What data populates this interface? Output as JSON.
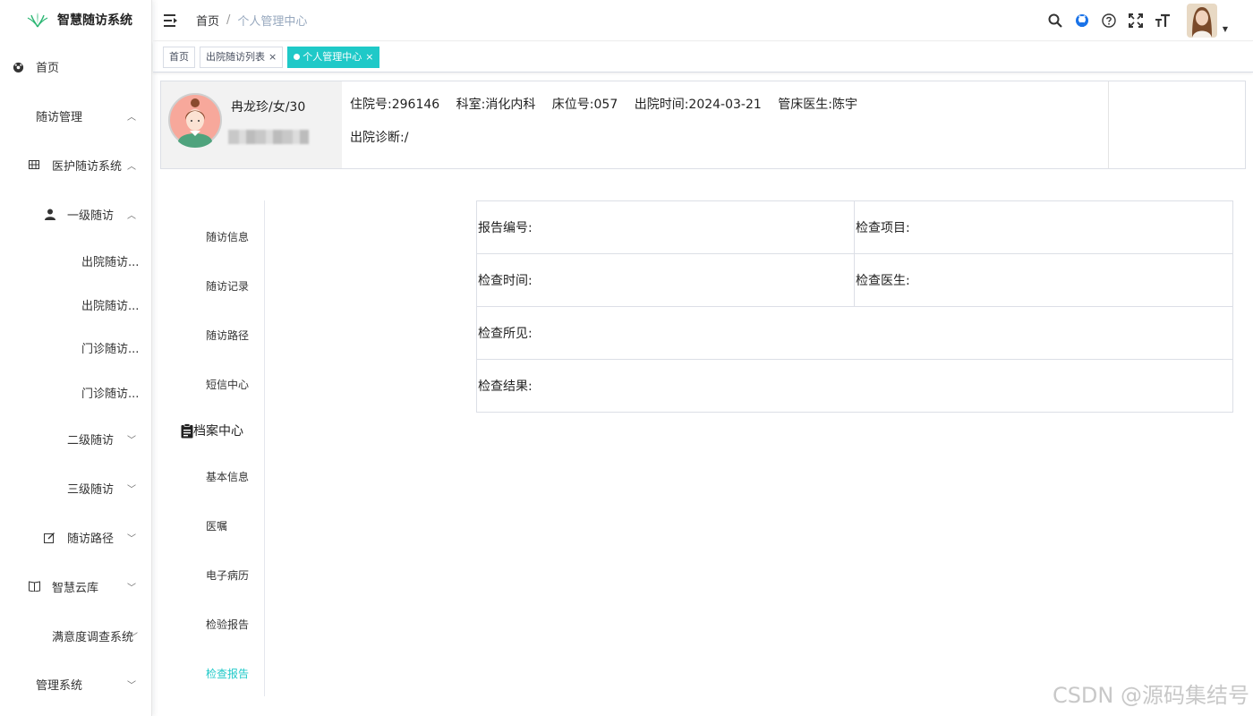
{
  "app": {
    "title": "智慧随访系统"
  },
  "sidebar": {
    "items": [
      {
        "label": "首页"
      },
      {
        "label": "随访管理"
      },
      {
        "label": "医护随访系统"
      },
      {
        "label": "一级随访"
      },
      {
        "label": "出院随访..."
      },
      {
        "label": "出院随访..."
      },
      {
        "label": "门诊随访..."
      },
      {
        "label": "门诊随访..."
      },
      {
        "label": "二级随访"
      },
      {
        "label": "三级随访"
      },
      {
        "label": "随访路径"
      },
      {
        "label": "智慧云库"
      },
      {
        "label": "满意度调查系统"
      },
      {
        "label": "管理系统"
      }
    ]
  },
  "header": {
    "breadcrumb_home": "首页",
    "breadcrumb_sep": "/",
    "breadcrumb_current": "个人管理中心"
  },
  "tags": [
    {
      "label": "首页"
    },
    {
      "label": "出院随访列表"
    },
    {
      "label": "个人管理中心"
    }
  ],
  "patient": {
    "name": "冉龙珍/女/30",
    "admission_no": "住院号:296146",
    "department": "科室:消化内科",
    "bed_no": "床位号:057",
    "discharge_time": "出院时间:2024-03-21",
    "doctor": "管床医生:陈宇",
    "diagnosis": "出院诊断:/"
  },
  "subnav": {
    "items_top": [
      "随访信息",
      "随访记录",
      "随访路径",
      "短信中心"
    ],
    "group_label": "档案中心",
    "items_bottom": [
      "基本信息",
      "医嘱",
      "电子病历",
      "检验报告",
      "检查报告"
    ]
  },
  "report": {
    "report_no": "报告编号:",
    "exam_item": "检查项目:",
    "exam_time": "检查时间:",
    "exam_doctor": "检查医生:",
    "findings": "检查所见:",
    "result": "检查结果:"
  },
  "watermark": "CSDN @源码集结号",
  "colors": {
    "accent": "#1fc9c8",
    "logo_green": "#2bb673",
    "link_blue": "#1a73e8"
  }
}
